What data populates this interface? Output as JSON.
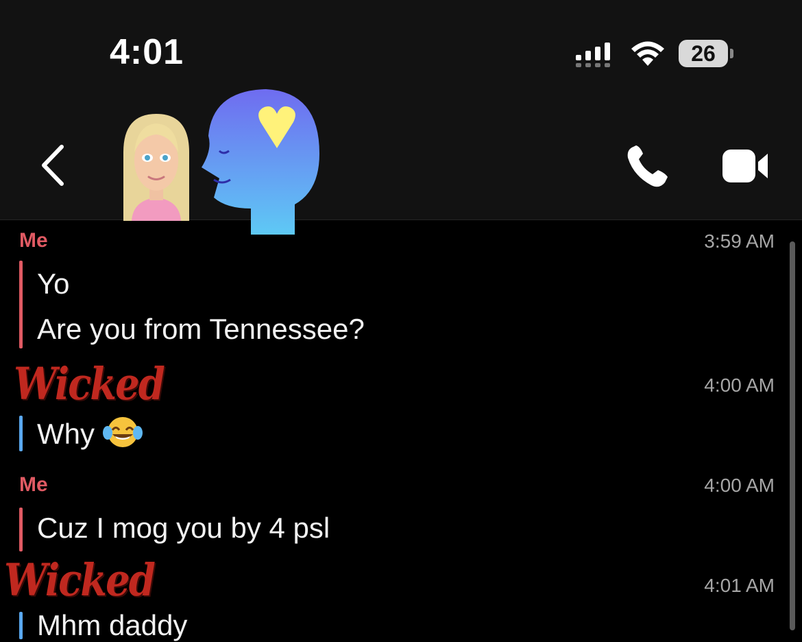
{
  "status_bar": {
    "time": "4:01",
    "battery": "26"
  },
  "header": {
    "back_icon": "chevron-left-icon",
    "call_icon": "phone-icon",
    "video_icon": "video-camera-icon"
  },
  "messages": [
    {
      "sender": "Me",
      "time": "3:59 AM",
      "lines": [
        "Yo",
        "Are you from Tennessee?"
      ],
      "color": "#e05a63"
    },
    {
      "sender": "Wicked",
      "time": "4:00 AM",
      "lines": [
        "Why"
      ],
      "emoji": "face-with-tears-of-joy",
      "color": "#5aa8f0"
    },
    {
      "sender": "Me",
      "time": "4:00 AM",
      "lines": [
        "Cuz I mog you by 4 psl"
      ],
      "color": "#e05a63"
    },
    {
      "sender": "Wicked",
      "time": "4:01 AM",
      "lines": [
        "Mhm daddy"
      ],
      "color": "#5aa8f0"
    }
  ]
}
